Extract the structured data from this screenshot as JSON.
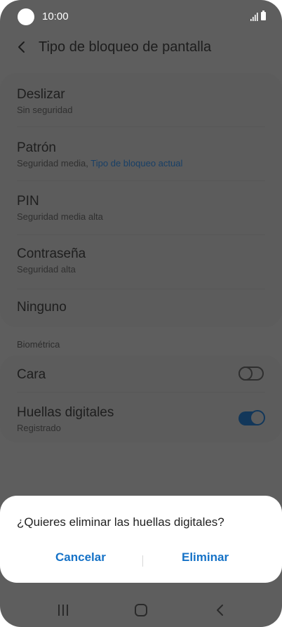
{
  "status_bar": {
    "time": "10:00"
  },
  "header": {
    "title": "Tipo de bloqueo de pantalla"
  },
  "lock_types": [
    {
      "title": "Deslizar",
      "subtitle": "Sin seguridad"
    },
    {
      "title": "Patrón",
      "subtitle": "Seguridad media,",
      "current": "Tipo de bloqueo actual"
    },
    {
      "title": "PIN",
      "subtitle": "Seguridad media alta"
    },
    {
      "title": "Contraseña",
      "subtitle": "Seguridad alta"
    },
    {
      "title": "Ninguno"
    }
  ],
  "biometrics": {
    "section_label": "Biométrica",
    "items": [
      {
        "title": "Cara",
        "enabled": false
      },
      {
        "title": "Huellas digitales",
        "subtitle": "Registrado",
        "enabled": true
      }
    ]
  },
  "dialog": {
    "message": "¿Quieres eliminar las huellas digitales?",
    "cancel_label": "Cancelar",
    "confirm_label": "Eliminar"
  },
  "colors": {
    "accent": "#1572c7",
    "overlay_background": "#5e5e5e",
    "dialog_background": "#ffffff"
  },
  "icons": {
    "status": [
      "camera-cutout",
      "signal-icon",
      "battery-icon"
    ],
    "header": [
      "back-arrow-icon"
    ],
    "navigation": [
      "recent-apps-icon",
      "home-icon",
      "back-icon"
    ]
  }
}
